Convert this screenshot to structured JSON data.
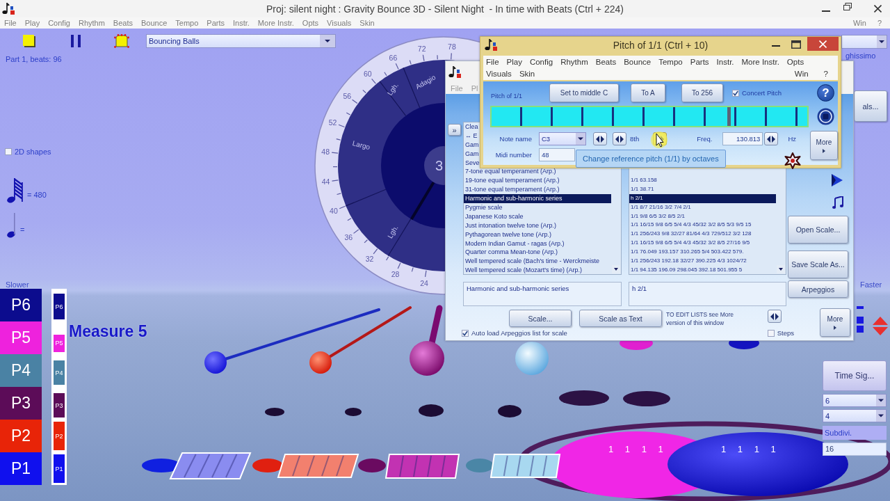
{
  "window": {
    "title": "Proj: silent night : Gravity Bounce 3D - Silent Night  - In time with Beats (Ctrl + 224)"
  },
  "menu": {
    "items": [
      "File",
      "Play",
      "Config",
      "Rhythm",
      "Beats",
      "Bounce",
      "Tempo",
      "Parts",
      "Instr.",
      "More Instr.",
      "Opts",
      "Visuals",
      "Skin"
    ],
    "right": [
      "Win",
      "?"
    ]
  },
  "toolbar": {
    "tools": [
      {
        "kind": "stop"
      },
      {
        "kind": "pause"
      },
      {
        "kind": "shape"
      }
    ],
    "visual": "Bouncing Balls"
  },
  "status": "Part 1, beats: 96",
  "shapes_2d": {
    "label": "2D shapes",
    "checked": false
  },
  "tempo_notes": [
    {
      "kind": "sixtyfourth",
      "reading": "= 480"
    },
    {
      "kind": "quarter",
      "reading": "="
    }
  ],
  "dial": {
    "ticks": [
      "24",
      "28",
      "32",
      "36",
      "40",
      "44",
      "48",
      "52",
      "56",
      "60",
      "66",
      "72",
      "78"
    ],
    "zones": [
      "Lgh.",
      "Largo",
      "Lgh.",
      "Adagio"
    ],
    "value": "3"
  },
  "speed": {
    "slower": "Slower",
    "faster": "Faster"
  },
  "parts": [
    {
      "label": "P6",
      "meter_label": "P6",
      "color": "#0c0c8e",
      "level": 0.9
    },
    {
      "label": "P5",
      "meter_label": "P5",
      "color": "#ee22dd",
      "level": 0.62
    },
    {
      "label": "P4",
      "meter_label": "P4",
      "color": "#4a82a4",
      "level": 0.85
    },
    {
      "label": "P3",
      "meter_label": "P3",
      "color": "#5c0c58",
      "level": 0.85
    },
    {
      "label": "P2",
      "meter_label": "P2",
      "color": "#e82408",
      "level": 1
    },
    {
      "label": "P1",
      "meter_label": "P1",
      "color": "#1010ee",
      "level": 1
    }
  ],
  "measure": "Measure 5",
  "floor_counts": [
    "1 1 1 1",
    "1 1 1 1"
  ],
  "right_panel": {
    "tempo_name": "ghissimo",
    "button": "als...",
    "time_sig": "Time Sig...",
    "beats": "6",
    "beat_unit": "4",
    "subdiv_label": "Subdivi.",
    "subdiv": "16"
  },
  "scale_window": {
    "menu": [
      "File",
      "Pl"
    ],
    "expand": "»",
    "scales": [
      {
        "text": "Clea",
        "selected": false
      },
      {
        "text": "↔ E",
        "selected": false
      },
      {
        "text": "Gam",
        "selected": false
      },
      {
        "text": "Gam",
        "selected": false
      },
      {
        "text": "Seve",
        "selected": false
      },
      {
        "text": "7-tone equal temperament (Arp.)",
        "selected": false
      },
      {
        "text": "19-tone equal temperament (Arp.)",
        "selected": false
      },
      {
        "text": "31-tone equal temperament (Arp.)",
        "selected": false
      },
      {
        "text": "Harmonic and sub-harmonic series",
        "selected": true
      },
      {
        "text": "Pygmie scale",
        "selected": false
      },
      {
        "text": "Japanese Koto scale",
        "selected": false
      },
      {
        "text": "Just intonation twelve tone (Arp.)",
        "selected": false
      },
      {
        "text": "Pythagorean twelve tone (Arp.)",
        "selected": false
      },
      {
        "text": "Modern Indian Gamut - ragas (Arp.)",
        "selected": false
      },
      {
        "text": "Quarter comma Mean-tone (Arp.)",
        "selected": false
      },
      {
        "text": "Well tempered scale (Bach's time - Werckmeiste",
        "selected": false
      },
      {
        "text": "Well tempered scale (Mozart's time) (Arp.)",
        "selected": false
      }
    ],
    "intervals": [
      {
        "text": "1/1 63.158",
        "selected": false
      },
      {
        "text": "1/1 38.71",
        "selected": false
      },
      {
        "text": "h 2/1",
        "selected": true
      },
      {
        "text": "1/1 8/7 21/16 3/2 7/4 2/1",
        "selected": false
      },
      {
        "text": "1/1 9/8 6/5 3/2 8/5 2/1",
        "selected": false
      },
      {
        "text": "1/1 16/15 9/8 6/5 5/4 4/3 45/32 3/2 8/5 5/3 9/5 15",
        "selected": false
      },
      {
        "text": "1/1 256/243 9/8 32/27 81/64 4/3 729/512 3/2 128",
        "selected": false
      },
      {
        "text": "1/1 16/15 9/8 6/5 5/4 4/3 45/32 3/2 8/5 27/16 9/5",
        "selected": false
      },
      {
        "text": "1/1 76.049 193.157 310.265 5/4 503.422 579.",
        "selected": false
      },
      {
        "text": "1/1 256/243 192.18 32/27 390.225 4/3 1024/72",
        "selected": false
      },
      {
        "text": "1/1 94.135 196.09 298.045 392.18 501.955 5",
        "selected": false
      }
    ],
    "scale_name": "Harmonic and sub-harmonic series",
    "scale_text": "h 2/1",
    "side_buttons": [
      "Open Scale...",
      "Save Scale As...",
      "Arpeggios"
    ],
    "buttons": [
      "Scale...",
      "Scale as Text"
    ],
    "note": "TO EDIT LISTS see More version of this window",
    "more": "More",
    "auto_load": {
      "label": "Auto load Arpeggios list for scale",
      "checked": true
    },
    "steps": {
      "label": "Steps",
      "checked": false
    }
  },
  "pitch_window": {
    "title": "Pitch of 1/1 (Ctrl + 10)",
    "menu": [
      "File",
      "Play",
      "Config",
      "Rhythm",
      "Beats",
      "Bounce",
      "Tempo",
      "Parts",
      "Instr.",
      "More Instr.",
      "Opts",
      "Visuals",
      "Skin"
    ],
    "menu_right": [
      "Win",
      "?"
    ],
    "pitch_label": "Pitch of 1/1",
    "buttons": [
      "Set to middle C",
      "To A",
      "To 256"
    ],
    "concert_pitch": {
      "label": "Concert Pitch",
      "checked": true
    },
    "help": "?",
    "strip": {
      "level": 0.75
    },
    "note_row": [
      {
        "kind": "label",
        "text": "Note name"
      },
      {
        "kind": "dropdown",
        "text": "C3"
      },
      {
        "kind": "spin",
        "hovered": false
      },
      {
        "kind": "spin",
        "hovered": false
      },
      {
        "kind": "text",
        "text": "8th"
      },
      {
        "kind": "spin",
        "hovered": true
      },
      {
        "kind": "label",
        "text": "Freq."
      },
      {
        "kind": "field",
        "text": "130.813"
      },
      {
        "kind": "spin",
        "hovered": false
      },
      {
        "kind": "text",
        "text": "Hz"
      }
    ],
    "midi_label": "Midi number",
    "midi": "48",
    "more": "More"
  },
  "tooltip": "Change reference pitch (1/1) by octaves"
}
